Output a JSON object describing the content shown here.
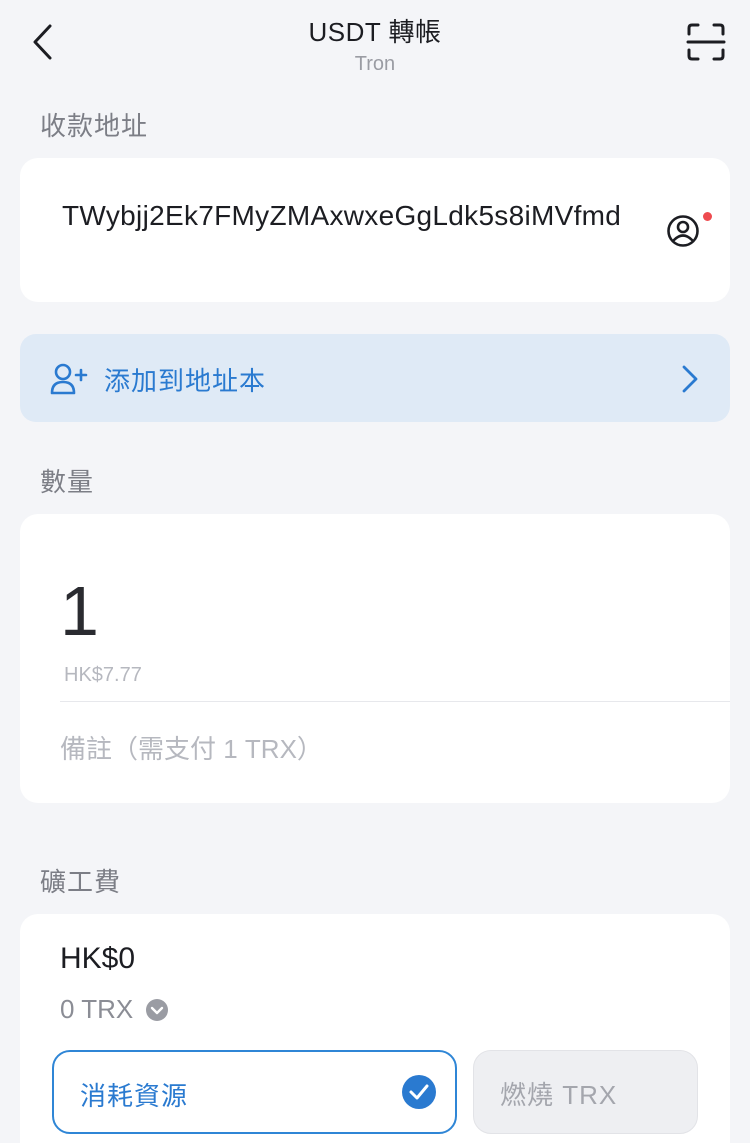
{
  "header": {
    "title": "USDT 轉帳",
    "subtitle": "Tron"
  },
  "recipient": {
    "section_label": "收款地址",
    "address": "TWybjj2Ek7FMyZMAxwxeGgLdk5s8iMVfmd"
  },
  "address_book": {
    "label": "添加到地址本"
  },
  "amount": {
    "section_label": "數量",
    "value": "1",
    "fiat_value": "HK$7.77",
    "memo_placeholder": "備註（需支付 1 TRX）"
  },
  "fee": {
    "section_label": "礦工費",
    "fiat": "HK$0",
    "token": "0 TRX",
    "options": [
      {
        "label": "消耗資源",
        "selected": true
      },
      {
        "label": "燃燒 TRX",
        "selected": false
      }
    ]
  },
  "colors": {
    "accent": "#2a7ad0",
    "background": "#f4f5f8",
    "banner": "#dfeaf6",
    "notification_dot": "#ee4b4f"
  }
}
